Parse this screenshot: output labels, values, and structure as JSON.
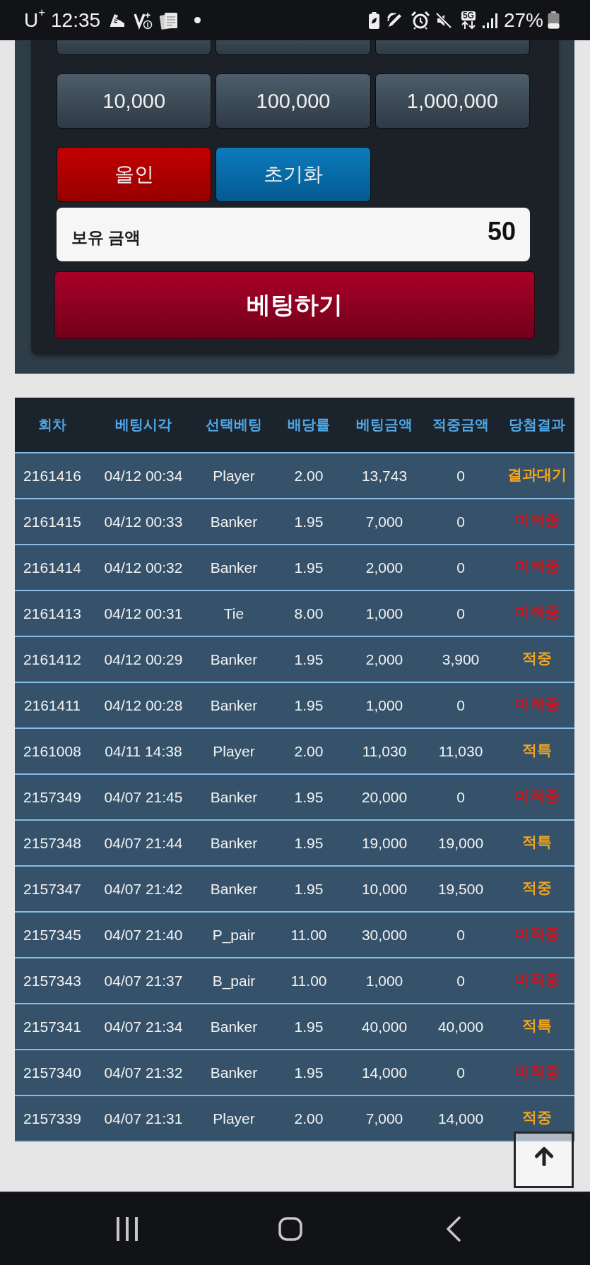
{
  "status_bar": {
    "carrier": "U$^{+}$",
    "time": "12:35",
    "network": "5G",
    "battery": "27%"
  },
  "bet_panel": {
    "amount_buttons": [
      {
        "cut_off": true
      },
      {
        "cut_off": true
      },
      {
        "cut_off": true
      },
      {
        "label": "10,000",
        "cut_off": false
      },
      {
        "label": "100,000",
        "cut_off": false
      },
      {
        "label": "1,000,000",
        "cut_off": false
      }
    ],
    "action_buttons": [
      {
        "label": "올인",
        "kind": "all_in"
      },
      {
        "label": "초기화",
        "kind": "reset"
      }
    ],
    "balance": {
      "label": "보유 금액",
      "value": "50"
    },
    "bet_button": "베팅하기"
  },
  "history": {
    "columns": [
      "회차",
      "베팅시각",
      "선택베팅",
      "배당률",
      "베팅금액",
      "적중금액",
      "당첨결과"
    ],
    "rows": [
      {
        "cells": [
          "2161416",
          "04/12 00:34",
          "Player",
          "2.00",
          "13,743",
          "0"
        ],
        "result": "결과대기",
        "color": "#f2a61d"
      },
      {
        "cells": [
          "2161415",
          "04/12 00:33",
          "Banker",
          "1.95",
          "7,000",
          "0"
        ],
        "result": "미적중",
        "color": "#d2121b"
      },
      {
        "cells": [
          "2161414",
          "04/12 00:32",
          "Banker",
          "1.95",
          "2,000",
          "0"
        ],
        "result": "미적중",
        "color": "#d2121b"
      },
      {
        "cells": [
          "2161413",
          "04/12 00:31",
          "Tie",
          "8.00",
          "1,000",
          "0"
        ],
        "result": "미적중",
        "color": "#d2121b"
      },
      {
        "cells": [
          "2161412",
          "04/12 00:29",
          "Banker",
          "1.95",
          "2,000",
          "3,900"
        ],
        "result": "적중",
        "color": "#f2a61d"
      },
      {
        "cells": [
          "2161411",
          "04/12 00:28",
          "Banker",
          "1.95",
          "1,000",
          "0"
        ],
        "result": "미적중",
        "color": "#d2121b"
      },
      {
        "cells": [
          "2161008",
          "04/11 14:38",
          "Player",
          "2.00",
          "11,030",
          "11,030"
        ],
        "result": "적특",
        "color": "#f2a61d"
      },
      {
        "cells": [
          "2157349",
          "04/07 21:45",
          "Banker",
          "1.95",
          "20,000",
          "0"
        ],
        "result": "미적중",
        "color": "#d2121b"
      },
      {
        "cells": [
          "2157348",
          "04/07 21:44",
          "Banker",
          "1.95",
          "19,000",
          "19,000"
        ],
        "result": "적특",
        "color": "#f2a61d"
      },
      {
        "cells": [
          "2157347",
          "04/07 21:42",
          "Banker",
          "1.95",
          "10,000",
          "19,500"
        ],
        "result": "적중",
        "color": "#f2a61d"
      },
      {
        "cells": [
          "2157345",
          "04/07 21:40",
          "P_pair",
          "11.00",
          "30,000",
          "0"
        ],
        "result": "미적중",
        "color": "#d2121b"
      },
      {
        "cells": [
          "2157343",
          "04/07 21:37",
          "B_pair",
          "11.00",
          "1,000",
          "0"
        ],
        "result": "미적중",
        "color": "#d2121b"
      },
      {
        "cells": [
          "2157341",
          "04/07 21:34",
          "Banker",
          "1.95",
          "40,000",
          "40,000"
        ],
        "result": "적특",
        "color": "#f2a61d"
      },
      {
        "cells": [
          "2157340",
          "04/07 21:32",
          "Banker",
          "1.95",
          "14,000",
          "0"
        ],
        "result": "미적중",
        "color": "#d2121b"
      },
      {
        "cells": [
          "2157339",
          "04/07 21:31",
          "Player",
          "2.00",
          "7,000",
          "14,000"
        ],
        "result": "적중",
        "color": "#f2a61d"
      }
    ]
  }
}
